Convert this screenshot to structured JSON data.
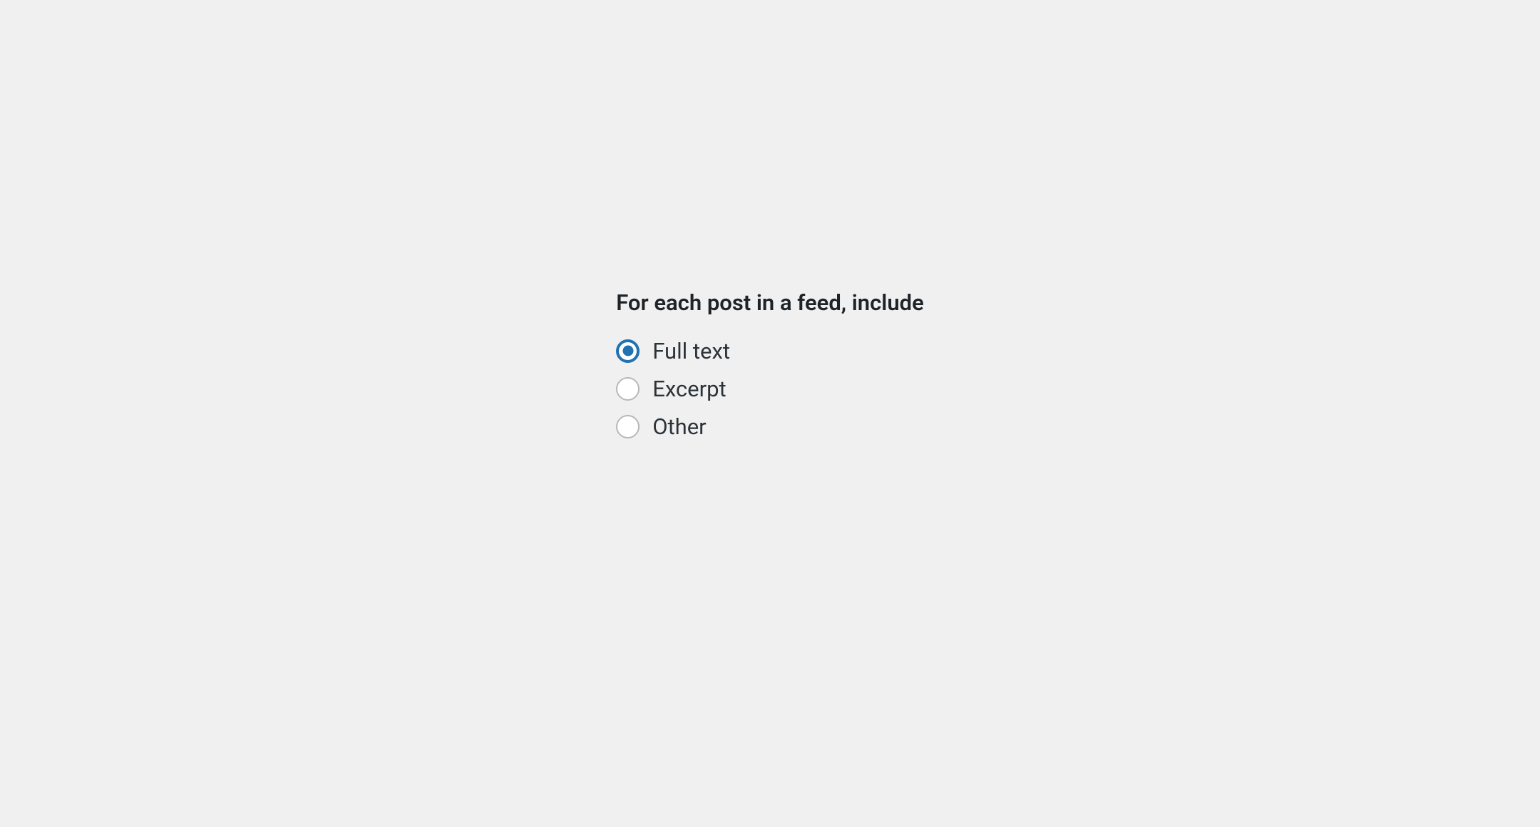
{
  "feed_include": {
    "legend": "For each post in a feed, include",
    "options": [
      {
        "id": "full_text",
        "label": "Full text",
        "checked": true
      },
      {
        "id": "excerpt",
        "label": "Excerpt",
        "checked": false
      },
      {
        "id": "other",
        "label": "Other",
        "checked": false
      }
    ]
  },
  "colors": {
    "accent": "#2271b1",
    "text_dark": "#1d2327",
    "text_body": "#2c3338",
    "bg": "#f0f0f1",
    "radio_border": "#b8b8b8"
  }
}
